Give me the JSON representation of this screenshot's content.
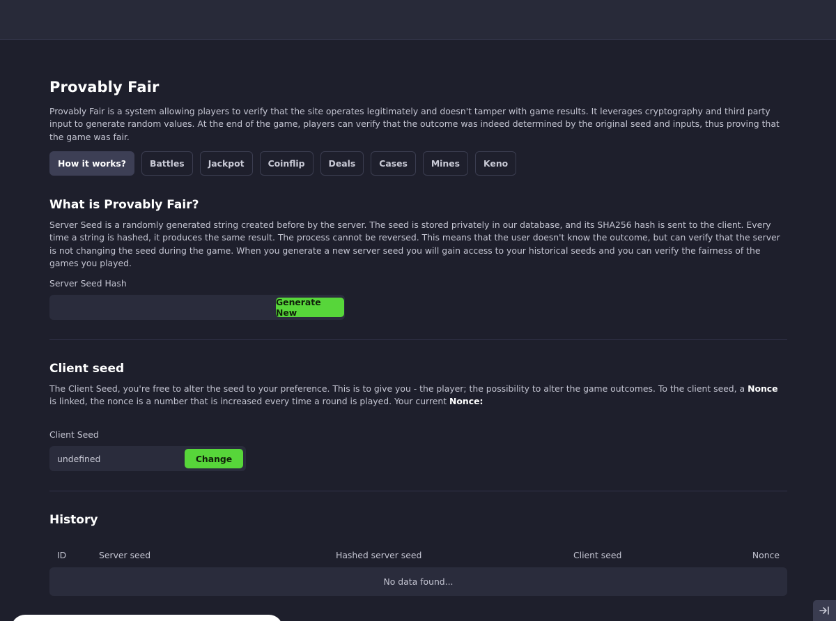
{
  "page": {
    "title": "Provably Fair",
    "intro": "Provably Fair is a system allowing players to verify that the site operates legitimately and doesn't tamper with game results. It leverages cryptography and third party input to generate random values. At the end of the game, players can verify that the outcome was indeed determined by the original seed and inputs, thus proving that the game was fair."
  },
  "tabs": [
    {
      "label": "How it works?",
      "active": true
    },
    {
      "label": "Battles",
      "active": false
    },
    {
      "label": "Jackpot",
      "active": false
    },
    {
      "label": "Coinflip",
      "active": false
    },
    {
      "label": "Deals",
      "active": false
    },
    {
      "label": "Cases",
      "active": false
    },
    {
      "label": "Mines",
      "active": false
    },
    {
      "label": "Keno",
      "active": false
    }
  ],
  "what_is": {
    "heading": "What is Provably Fair?",
    "body": "Server Seed is a randomly generated string created before by the server. The seed is stored privately in our database, and its SHA256 hash is sent to the client. Every time a string is hashed, it produces the same result. The process cannot be reversed. This means that the user doesn't know the outcome, but can verify that the server is not changing the seed during the game. When you generate a new server seed you will gain access to your historical seeds and you can verify the fairness of the games you played.",
    "field_label": "Server Seed Hash",
    "field_value": "",
    "button": "Generate New"
  },
  "client_seed": {
    "heading": "Client seed",
    "body_part1": "The Client Seed, you're free to alter the seed to your preference. This is to give you - the player; the possibility to alter the game outcomes. To the client seed, a ",
    "nonce_word": "Nonce",
    "body_part2": " is linked, the nonce is a number that is increased every time a round is played. Your current ",
    "nonce_label": "Nonce:",
    "field_label": "Client Seed",
    "field_value": "undefined",
    "button": "Change"
  },
  "history": {
    "heading": "History",
    "columns": [
      "ID",
      "Server seed",
      "Hashed server seed",
      "Client seed",
      "Nonce"
    ],
    "empty_text": "No data found..."
  },
  "icons": {
    "collapse": "collapse-arrow-icon"
  },
  "colors": {
    "background": "#1e1f2c",
    "accent_green": "#57d63a",
    "active_tab": "#3d3f55"
  }
}
